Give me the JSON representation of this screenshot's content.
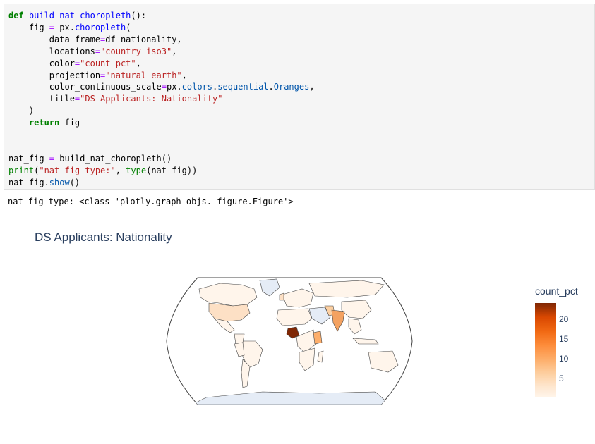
{
  "code": {
    "lines": [
      [
        [
          "kw",
          "def "
        ],
        [
          "fn",
          "build_nat_choropleth"
        ],
        [
          "",
          "():"
        ]
      ],
      [
        [
          "",
          "    fig "
        ],
        [
          "op",
          "="
        ],
        [
          "",
          " px."
        ],
        [
          "fn",
          "choropleth"
        ],
        [
          "",
          "("
        ]
      ],
      [
        [
          "",
          "        data_frame"
        ],
        [
          "op",
          "="
        ],
        [
          "",
          "df_nationality,"
        ]
      ],
      [
        [
          "",
          "        locations"
        ],
        [
          "op",
          "="
        ],
        [
          "str",
          "\"country_iso3\""
        ],
        [
          "",
          ","
        ]
      ],
      [
        [
          "",
          "        color"
        ],
        [
          "op",
          "="
        ],
        [
          "str",
          "\"count_pct\""
        ],
        [
          "",
          ","
        ]
      ],
      [
        [
          "",
          "        projection"
        ],
        [
          "op",
          "="
        ],
        [
          "str",
          "\"natural earth\""
        ],
        [
          "",
          ","
        ]
      ],
      [
        [
          "",
          "        color_continuous_scale"
        ],
        [
          "op",
          "="
        ],
        [
          "",
          "px."
        ],
        [
          "pkg",
          "colors"
        ],
        [
          "",
          "."
        ],
        [
          "pkg",
          "sequential"
        ],
        [
          "",
          "."
        ],
        [
          "pkg",
          "Oranges"
        ],
        [
          "",
          ","
        ]
      ],
      [
        [
          "",
          "        title"
        ],
        [
          "op",
          "="
        ],
        [
          "str",
          "\"DS Applicants: Nationality\""
        ]
      ],
      [
        [
          "",
          "    )"
        ]
      ],
      [
        [
          "kw",
          "    return"
        ],
        [
          "",
          " fig"
        ]
      ],
      [
        [
          "",
          ""
        ]
      ],
      [
        [
          "",
          ""
        ]
      ],
      [
        [
          "",
          "nat_fig "
        ],
        [
          "op",
          "="
        ],
        [
          "",
          " build_nat_choropleth()"
        ]
      ],
      [
        [
          "bi",
          "print"
        ],
        [
          "",
          "("
        ],
        [
          "str",
          "\"nat_fig type:\""
        ],
        [
          "",
          ", "
        ],
        [
          "bi",
          "type"
        ],
        [
          "",
          "(nat_fig))"
        ]
      ],
      [
        [
          "",
          "nat_fig."
        ],
        [
          "pkg",
          "show"
        ],
        [
          "",
          "()"
        ]
      ]
    ]
  },
  "output": {
    "text": "nat_fig type: <class 'plotly.graph_objs._figure.Figure'>"
  },
  "figure": {
    "title": "DS Applicants: Nationality",
    "colorbar_title": "count_pct",
    "colorbar_ticks": [
      "20",
      "15",
      "10",
      "5"
    ],
    "colorscale": "Oranges",
    "projection": "natural earth",
    "colors": {
      "max": "#7f2704",
      "high": "#d94801",
      "mid": "#f4a261",
      "low": "#fde0c5",
      "min": "#fff5eb",
      "nodata": "#e5ecf6",
      "title": "#2a3f5f"
    }
  }
}
